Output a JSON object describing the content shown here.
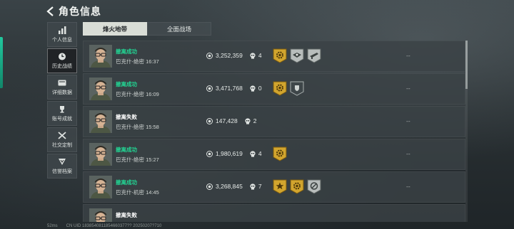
{
  "header": {
    "back_icon": "back-arrow-icon",
    "title": "角色信息"
  },
  "sidebar": {
    "items": [
      {
        "label": "个人信息",
        "icon": "bar-chart-icon",
        "active": false
      },
      {
        "label": "历史战绩",
        "icon": "clock-icon",
        "active": true
      },
      {
        "label": "详细数据",
        "icon": "card-icon",
        "active": false
      },
      {
        "label": "账号成就",
        "icon": "trophy-icon",
        "active": false
      },
      {
        "label": "社交定制",
        "icon": "tools-icon",
        "active": false
      },
      {
        "label": "信誉档案",
        "icon": "shield-icon",
        "active": false
      }
    ]
  },
  "tabs": [
    {
      "label": "烽火地带",
      "active": true
    },
    {
      "label": "全面战场",
      "active": false
    }
  ],
  "records": [
    {
      "result": "撤离成功",
      "success": true,
      "map_time": "巴克什-绝密 16:37",
      "value": "3,252,359",
      "kills": "4",
      "medals": [
        "gold-cog-medal-icon",
        "silver-winged-medal-icon",
        "silver-gun-medal-icon"
      ],
      "extra": "--"
    },
    {
      "result": "撤离成功",
      "success": true,
      "map_time": "巴克什-绝密 16:09",
      "value": "3,471,768",
      "kills": "0",
      "medals": [
        "gold-cog-medal-icon",
        "dark-shield-medal-icon"
      ],
      "extra": "--"
    },
    {
      "result": "撤离失败",
      "success": false,
      "map_time": "巴克什-绝密 15:58",
      "value": "147,428",
      "kills": "2",
      "medals": [],
      "extra": "--"
    },
    {
      "result": "撤离成功",
      "success": true,
      "map_time": "巴克什-绝密 15:27",
      "value": "1,980,619",
      "kills": "4",
      "medals": [
        "gold-cog-medal-icon"
      ],
      "extra": "--"
    },
    {
      "result": "撤离成功",
      "success": true,
      "map_time": "巴克什-机密 14:45",
      "value": "3,268,845",
      "kills": "7",
      "medals": [
        "gold-star-medal-icon",
        "gold-cog-medal-icon",
        "silver-slash-medal-icon"
      ],
      "extra": "--"
    },
    {
      "result": "撤离失败",
      "success": false,
      "map_time": "",
      "value": "",
      "kills": "",
      "medals": [],
      "extra": ""
    }
  ],
  "colors": {
    "success": "#22d694",
    "fail": "#ffffff",
    "gold": "#d2a52e",
    "silver": "#b8bdbc",
    "accent": "#1fd7a8"
  },
  "status": {
    "ping": "52ms",
    "uid": "CN UID 1838540811854660377?? 20250207?710"
  }
}
